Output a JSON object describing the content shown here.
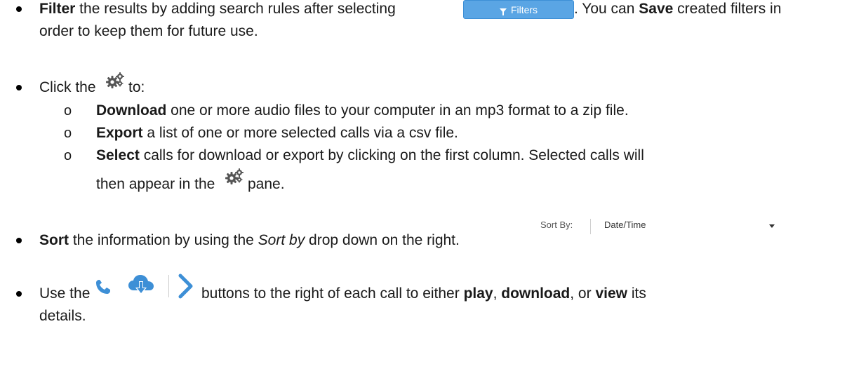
{
  "colors": {
    "accent": "#5aa5e4",
    "icon_blue": "#3d8fd6",
    "gear_gray": "#555555"
  },
  "filter_item": {
    "bold1": "Filter",
    "text1": " the results by adding search rules after selecting",
    "text2": ". You can ",
    "bold2": "Save",
    "text3": " created filters in",
    "line2": "order to keep them for future use.",
    "button_label": "Filters",
    "button_icon": "funnel-icon"
  },
  "click_item": {
    "text1": "Click the",
    "text2": " to:",
    "icon": "gears-icon"
  },
  "sub_items": [
    {
      "marker": "o",
      "bold": "Download",
      "text": " one or more audio files to your computer in an mp3 format to a zip file."
    },
    {
      "marker": "o",
      "bold": "Export",
      "text": " a list of one or more selected calls via a csv file."
    },
    {
      "marker": "o",
      "bold": "Select",
      "text": " calls for download or export by clicking on the first column. Selected calls will"
    }
  ],
  "select_cont": {
    "text1": "then appear in the",
    "text2": " pane."
  },
  "sort_item": {
    "bold": "Sort",
    "text1": " the information by using the ",
    "italic": "Sort by",
    "text2": " drop down on the right.",
    "dropdown_label": "Sort By:",
    "dropdown_value": "Date/Time"
  },
  "use_item": {
    "text1": "Use the",
    "text2": " buttons to the right of each call to either ",
    "bold1": "play",
    "sep1": ", ",
    "bold2": "download",
    "sep2": ", or ",
    "bold3": "view",
    "text3": " its",
    "line2": "details.",
    "icons": [
      "phone-icon",
      "cloud-download-icon",
      "chevron-right-icon"
    ]
  }
}
